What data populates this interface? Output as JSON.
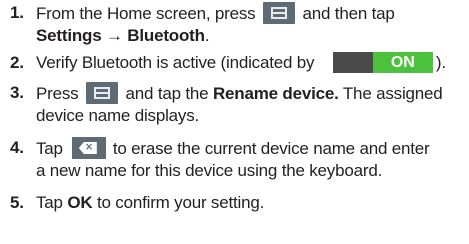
{
  "steps": [
    {
      "number": "1.",
      "line1_pre": "From the Home screen, press",
      "menu_icon": "menu-key-icon",
      "line1_post": "and then tap",
      "line2_bold": "Settings → Bluetooth",
      "line2_post": "."
    },
    {
      "number": "2.",
      "pre": "Verify Bluetooth is active (indicated by",
      "toggle_label": "ON",
      "post": ")."
    },
    {
      "number": "3.",
      "line1_pre": "Press",
      "menu_icon": "menu-key-icon",
      "line1_mid": "and tap the",
      "line1_bold": "Rename device.",
      "line1_post": "The assigned",
      "line2": "device name displays."
    },
    {
      "number": "4.",
      "line1_pre": "Tap",
      "delete_icon": "delete-key-icon",
      "line1_post": "to erase the current device name and enter",
      "line2": "a new name for this device using the keyboard."
    },
    {
      "number": "5.",
      "pre": "Tap",
      "bold": "OK",
      "post": "to confirm your setting."
    }
  ],
  "colors": {
    "text": "#231f20",
    "key_background": "#5f6b74",
    "toggle_off": "#4a4a4a",
    "toggle_on": "#4cc13d"
  }
}
